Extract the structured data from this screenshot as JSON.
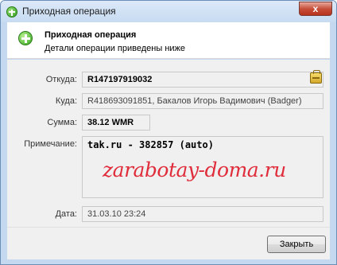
{
  "window": {
    "title": "Приходная операция",
    "close_glyph": "x"
  },
  "header": {
    "title": "Приходная операция",
    "subtitle": "Детали операции приведены ниже",
    "icon": "green-plus-icon"
  },
  "fields": {
    "from_label": "Откуда:",
    "from_value": "R147197919032",
    "to_label": "Куда:",
    "to_value": "R418693091851, Бакалов Игорь Вадимович (Badger)",
    "amount_label": "Сумма:",
    "amount_value": "38.12 WMR",
    "note_label": "Примечание:",
    "note_value": "tak.ru - 382857  (auto)",
    "date_label": "Дата:",
    "date_value": "31.03.10 23:24"
  },
  "watermark": {
    "text": "zarabotay-doma.ru",
    "color": "#e02d3c"
  },
  "footer": {
    "close_label": "Закрыть"
  },
  "colors": {
    "titlebar": "#c7dbf1",
    "accent_green": "#34a51d",
    "close_red": "#c7503b"
  }
}
